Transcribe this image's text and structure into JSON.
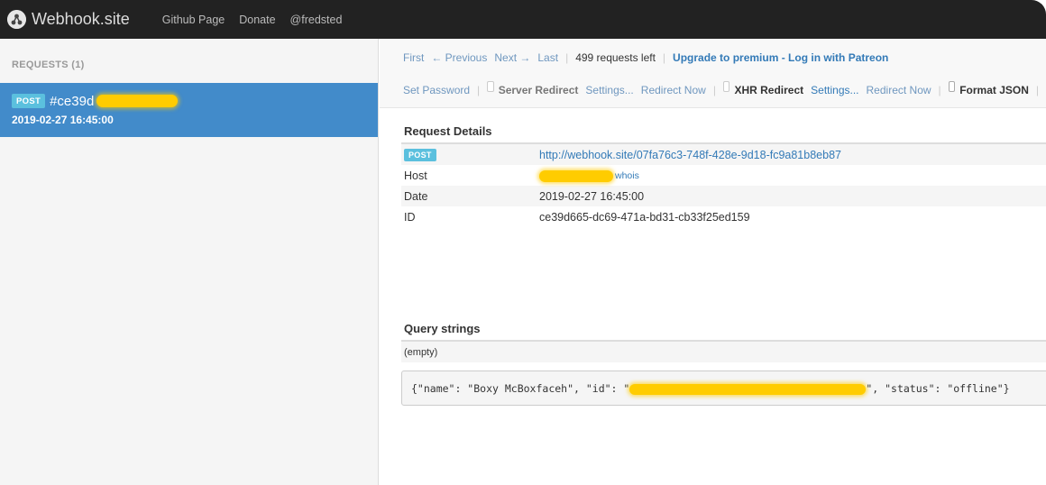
{
  "navbar": {
    "brand": "Webhook.site",
    "links": [
      "Github Page",
      "Donate",
      "@fredsted"
    ]
  },
  "sidebar": {
    "header": "REQUESTS (1)",
    "requests": [
      {
        "method": "POST",
        "id_prefix": "#ce39d",
        "date": "2019-02-27 16:45:00"
      }
    ]
  },
  "toolbar": {
    "first": "First",
    "previous": "← Previous",
    "next": "Next →",
    "last": "Last",
    "requests_left": "499 requests left",
    "upgrade": "Upgrade to premium - Log in with Patreon",
    "set_password": "Set Password",
    "server_redirect": "Server Redirect",
    "settings": "Settings...",
    "redirect_now": "Redirect Now",
    "xhr_redirect": "XHR Redirect",
    "format_json": "Format JSON"
  },
  "details": {
    "title": "Request Details",
    "method": "POST",
    "url": "http://webhook.site/07fa76c3-748f-428e-9d18-fc9a81b8eb87",
    "host_label": "Host",
    "whois": "whois",
    "date_label": "Date",
    "date": "2019-02-27 16:45:00",
    "id_label": "ID",
    "id": "ce39d665-dc69-471a-bd31-cb33f25ed159"
  },
  "query": {
    "title": "Query strings",
    "value": "(empty)"
  },
  "body": {
    "part1": "{\"name\": \"Boxy McBoxfaceh\", \"id\": \"",
    "part2": "\", \"status\": \"offline\"}"
  },
  "colors": {
    "navbar": "#222222",
    "selected": "#428bca",
    "badge": "#5bc0de",
    "redaction": "#ffcc00",
    "link": "#337ab7"
  }
}
